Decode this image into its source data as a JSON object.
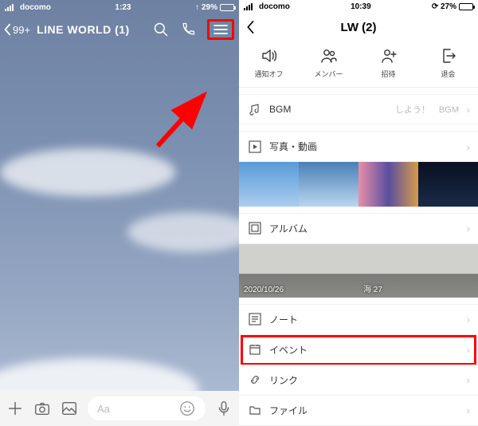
{
  "left": {
    "status": {
      "carrier": "docomo",
      "time": "1:23",
      "loc_arrow": "↑",
      "battery_pct": "29%"
    },
    "header": {
      "back_count": "99+",
      "title": "LINE  WORLD (1)"
    },
    "input": {
      "placeholder": "Aa"
    }
  },
  "right": {
    "status": {
      "carrier": "docomo",
      "time": "10:39",
      "battery_pct": "27%"
    },
    "header": {
      "title": "LW (2)"
    },
    "actions": {
      "a1": "通知オフ",
      "a2": "メンバー",
      "a3": "招待",
      "a4": "退会"
    },
    "rows": {
      "bgm_label": "BGM",
      "bgm_right": "しよう！　BGM",
      "photos": "写真・動画",
      "album": "アルバム",
      "album_date1": "2020/10/26",
      "album_date2": "海 27",
      "note": "ノート",
      "event": "イベント",
      "link": "リンク",
      "file": "ファイル"
    }
  }
}
